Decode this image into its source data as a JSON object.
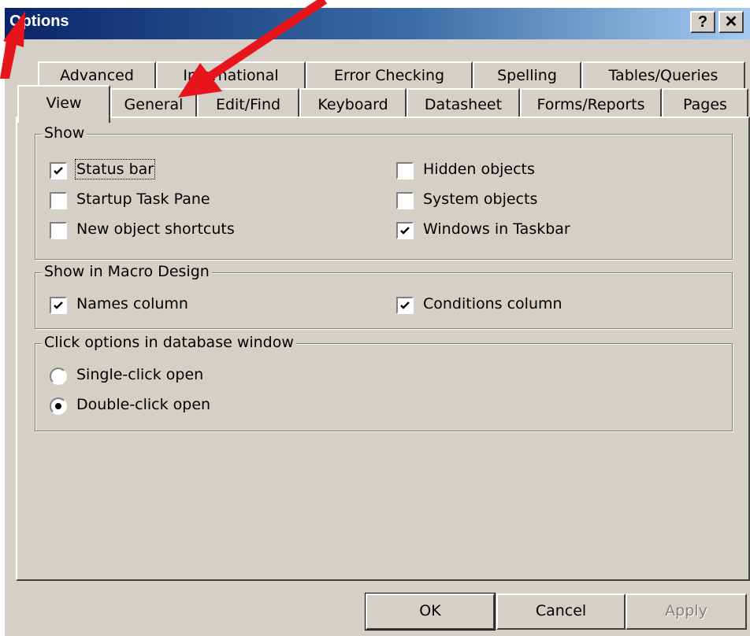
{
  "window": {
    "title": "Options",
    "help_label": "?",
    "close_label": "✕"
  },
  "tabs": {
    "row1": [
      "Advanced",
      "International",
      "Error Checking",
      "Spelling",
      "Tables/Queries"
    ],
    "row2": [
      "View",
      "General",
      "Edit/Find",
      "Keyboard",
      "Datasheet",
      "Forms/Reports",
      "Pages"
    ],
    "active": "View"
  },
  "show": {
    "title": "Show",
    "status_bar": "Status bar",
    "startup_task_pane": "Startup Task Pane",
    "new_object_shortcuts": "New object shortcuts",
    "hidden_objects": "Hidden objects",
    "system_objects": "System objects",
    "windows_in_taskbar": "Windows in Taskbar"
  },
  "macro": {
    "title": "Show in Macro Design",
    "names_column": "Names column",
    "conditions_column": "Conditions column"
  },
  "click": {
    "title": "Click options in database window",
    "single": "Single-click open",
    "double": "Double-click open"
  },
  "buttons": {
    "ok": "OK",
    "cancel": "Cancel",
    "apply": "Apply"
  },
  "colors": {
    "annotation_arrow": "#e8141b",
    "titlebar_start": "#0a246a",
    "face": "#d4d0c8"
  }
}
